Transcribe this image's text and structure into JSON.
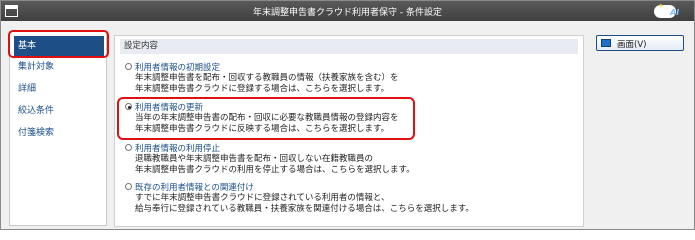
{
  "window": {
    "title": "年末調整申告書クラウド利用者保守 - 条件設定"
  },
  "sidebar": {
    "items": [
      {
        "label": "基本"
      },
      {
        "label": "集計対象"
      },
      {
        "label": "詳細"
      },
      {
        "label": "絞込条件"
      },
      {
        "label": "付箋検索"
      }
    ]
  },
  "panel": {
    "header": "設定内容",
    "options": [
      {
        "label": "利用者情報の初期設定",
        "lines": [
          "年末調整申告書を配布・回収する教職員の情報（扶養家族を含む）を",
          "年末調整申告書クラウドに登録する場合は、こちらを選択します。"
        ]
      },
      {
        "label": "利用者情報の更新",
        "lines": [
          "当年の年末調整申告書の配布・回収に必要な教職員情報の登録内容を",
          "年末調整申告書クラウドに反映する場合は、こちらを選択します。"
        ]
      },
      {
        "label": "利用者情報の利用停止",
        "lines": [
          "退職教職員や年末調整申告書を配布・回収しない在籍教職員の",
          "年末調整申告書クラウドの利用を停止する場合は、こちらを選択します。"
        ]
      },
      {
        "label": "既存の利用者情報との関連付け",
        "lines": [
          "すでに年末調整申告書クラウドに登録されている利用者の情報と、",
          "給与奉行に登録されている教職員・扶養家族を関連付ける場合は、こちらを選択します。"
        ]
      }
    ]
  },
  "buttons": {
    "screen": "画面(V)"
  }
}
